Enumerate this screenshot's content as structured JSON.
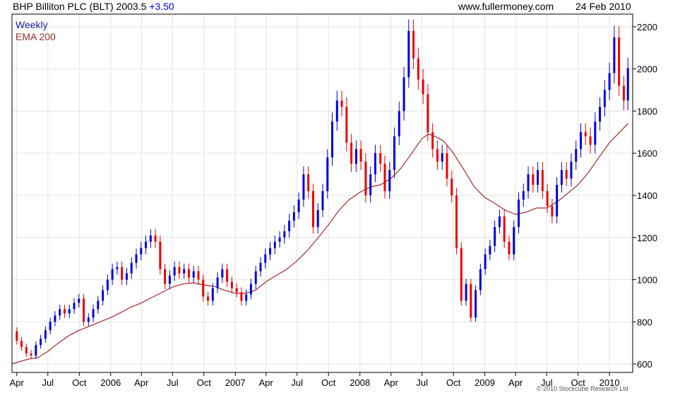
{
  "header": {
    "title": "BHP Billiton PLC (BLT) 2003.5",
    "change": "+3.50",
    "site": "www.fullermoney.com",
    "date": "24 Feb 2010"
  },
  "legend": {
    "weekly": "Weekly",
    "ema": "EMA 200"
  },
  "copyright": "© 2010 Stockcube Research Ltd",
  "colors": {
    "up": "#0000dd",
    "down": "#ee0000",
    "ema": "#a52a2a",
    "grid": "#e3e3e3",
    "frame": "#000000"
  },
  "chart_data": {
    "type": "line",
    "title": "BHP Billiton PLC (BLT)",
    "xlabel": "",
    "ylabel": "",
    "ylim": [
      560,
      2260
    ],
    "y_ticks": [
      600,
      800,
      1000,
      1200,
      1400,
      1600,
      1800,
      2000,
      2200
    ],
    "x_tick_labels": [
      "Apr",
      "Jul",
      "Oct",
      "2006",
      "Apr",
      "Jul",
      "Oct",
      "2007",
      "Apr",
      "Jul",
      "Oct",
      "2008",
      "Apr",
      "Jul",
      "Oct",
      "2009",
      "Apr",
      "Jul",
      "Oct",
      "2010"
    ],
    "x_range": [
      "2005-03-18",
      "2010-02-24"
    ],
    "grid": true,
    "series": [
      {
        "name": "Weekly",
        "style": "bars",
        "points": [
          [
            "2005-03-18",
            755
          ],
          [
            "2005-04-01",
            710
          ],
          [
            "2005-04-15",
            680
          ],
          [
            "2005-04-29",
            650
          ],
          [
            "2005-05-13",
            640
          ],
          [
            "2005-05-27",
            690
          ],
          [
            "2005-06-10",
            720
          ],
          [
            "2005-06-24",
            760
          ],
          [
            "2005-07-08",
            800
          ],
          [
            "2005-07-22",
            830
          ],
          [
            "2005-08-05",
            860
          ],
          [
            "2005-08-19",
            840
          ],
          [
            "2005-09-02",
            860
          ],
          [
            "2005-09-16",
            890
          ],
          [
            "2005-09-30",
            910
          ],
          [
            "2005-10-14",
            800
          ],
          [
            "2005-10-28",
            820
          ],
          [
            "2005-11-11",
            860
          ],
          [
            "2005-11-25",
            900
          ],
          [
            "2005-12-09",
            950
          ],
          [
            "2005-12-23",
            1000
          ],
          [
            "2006-01-06",
            1050
          ],
          [
            "2006-01-20",
            1060
          ],
          [
            "2006-02-03",
            1000
          ],
          [
            "2006-02-17",
            1030
          ],
          [
            "2006-03-03",
            1080
          ],
          [
            "2006-03-17",
            1120
          ],
          [
            "2006-03-31",
            1150
          ],
          [
            "2006-04-14",
            1180
          ],
          [
            "2006-04-28",
            1210
          ],
          [
            "2006-05-12",
            1180
          ],
          [
            "2006-05-26",
            1050
          ],
          [
            "2006-06-09",
            980
          ],
          [
            "2006-06-23",
            1020
          ],
          [
            "2006-07-07",
            1060
          ],
          [
            "2006-07-21",
            1030
          ],
          [
            "2006-08-04",
            1050
          ],
          [
            "2006-08-18",
            1010
          ],
          [
            "2006-09-01",
            1040
          ],
          [
            "2006-09-15",
            1000
          ],
          [
            "2006-09-29",
            920
          ],
          [
            "2006-10-13",
            900
          ],
          [
            "2006-10-27",
            960
          ],
          [
            "2006-11-10",
            1010
          ],
          [
            "2006-11-24",
            1050
          ],
          [
            "2006-12-08",
            990
          ],
          [
            "2006-12-22",
            960
          ],
          [
            "2007-01-05",
            940
          ],
          [
            "2007-01-19",
            900
          ],
          [
            "2007-02-02",
            930
          ],
          [
            "2007-02-16",
            980
          ],
          [
            "2007-03-02",
            1040
          ],
          [
            "2007-03-16",
            1080
          ],
          [
            "2007-03-30",
            1120
          ],
          [
            "2007-04-13",
            1150
          ],
          [
            "2007-04-27",
            1180
          ],
          [
            "2007-05-11",
            1200
          ],
          [
            "2007-05-25",
            1230
          ],
          [
            "2007-06-08",
            1280
          ],
          [
            "2007-06-22",
            1320
          ],
          [
            "2007-07-06",
            1380
          ],
          [
            "2007-07-20",
            1500
          ],
          [
            "2007-08-03",
            1420
          ],
          [
            "2007-08-17",
            1250
          ],
          [
            "2007-08-31",
            1330
          ],
          [
            "2007-09-14",
            1420
          ],
          [
            "2007-09-28",
            1580
          ],
          [
            "2007-10-12",
            1750
          ],
          [
            "2007-10-26",
            1850
          ],
          [
            "2007-11-09",
            1820
          ],
          [
            "2007-11-23",
            1650
          ],
          [
            "2007-12-07",
            1550
          ],
          [
            "2007-12-21",
            1620
          ],
          [
            "2008-01-04",
            1560
          ],
          [
            "2008-01-18",
            1400
          ],
          [
            "2008-02-01",
            1500
          ],
          [
            "2008-02-15",
            1600
          ],
          [
            "2008-03-01",
            1550
          ],
          [
            "2008-03-14",
            1420
          ],
          [
            "2008-03-28",
            1520
          ],
          [
            "2008-04-11",
            1680
          ],
          [
            "2008-04-25",
            1800
          ],
          [
            "2008-05-09",
            1960
          ],
          [
            "2008-05-23",
            2180
          ],
          [
            "2008-06-06",
            2050
          ],
          [
            "2008-06-20",
            1950
          ],
          [
            "2008-07-04",
            1880
          ],
          [
            "2008-07-18",
            1700
          ],
          [
            "2008-08-01",
            1620
          ],
          [
            "2008-08-15",
            1560
          ],
          [
            "2008-08-29",
            1600
          ],
          [
            "2008-09-12",
            1480
          ],
          [
            "2008-09-26",
            1400
          ],
          [
            "2008-10-10",
            1150
          ],
          [
            "2008-10-24",
            900
          ],
          [
            "2008-11-07",
            980
          ],
          [
            "2008-11-21",
            820
          ],
          [
            "2008-12-05",
            950
          ],
          [
            "2008-12-19",
            1050
          ],
          [
            "2009-01-02",
            1120
          ],
          [
            "2009-01-16",
            1160
          ],
          [
            "2009-01-30",
            1250
          ],
          [
            "2009-02-13",
            1300
          ],
          [
            "2009-02-27",
            1180
          ],
          [
            "2009-03-13",
            1120
          ],
          [
            "2009-03-27",
            1250
          ],
          [
            "2009-04-10",
            1380
          ],
          [
            "2009-04-24",
            1420
          ],
          [
            "2009-05-08",
            1500
          ],
          [
            "2009-05-22",
            1450
          ],
          [
            "2009-06-05",
            1520
          ],
          [
            "2009-06-19",
            1420
          ],
          [
            "2009-07-03",
            1350
          ],
          [
            "2009-07-17",
            1300
          ],
          [
            "2009-07-31",
            1450
          ],
          [
            "2009-08-14",
            1520
          ],
          [
            "2009-08-28",
            1480
          ],
          [
            "2009-09-11",
            1560
          ],
          [
            "2009-09-25",
            1620
          ],
          [
            "2009-10-09",
            1700
          ],
          [
            "2009-10-23",
            1680
          ],
          [
            "2009-11-06",
            1640
          ],
          [
            "2009-11-20",
            1750
          ],
          [
            "2009-12-04",
            1820
          ],
          [
            "2009-12-18",
            1900
          ],
          [
            "2010-01-01",
            1980
          ],
          [
            "2010-01-15",
            2150
          ],
          [
            "2010-01-29",
            1920
          ],
          [
            "2010-02-12",
            1850
          ],
          [
            "2010-02-24",
            2003.5
          ]
        ]
      },
      {
        "name": "EMA 200",
        "style": "line",
        "points": [
          [
            "2005-03-18",
            600
          ],
          [
            "2005-05-01",
            622
          ],
          [
            "2005-06-01",
            630
          ],
          [
            "2005-07-01",
            660
          ],
          [
            "2005-08-01",
            700
          ],
          [
            "2005-09-01",
            735
          ],
          [
            "2005-10-01",
            760
          ],
          [
            "2005-11-01",
            780
          ],
          [
            "2005-12-01",
            800
          ],
          [
            "2006-01-01",
            820
          ],
          [
            "2006-02-01",
            845
          ],
          [
            "2006-03-01",
            870
          ],
          [
            "2006-04-01",
            890
          ],
          [
            "2006-05-01",
            915
          ],
          [
            "2006-06-01",
            940
          ],
          [
            "2006-07-01",
            965
          ],
          [
            "2006-08-01",
            980
          ],
          [
            "2006-09-01",
            985
          ],
          [
            "2006-10-01",
            975
          ],
          [
            "2006-11-01",
            968
          ],
          [
            "2006-12-01",
            950
          ],
          [
            "2007-01-01",
            935
          ],
          [
            "2007-02-01",
            935
          ],
          [
            "2007-03-01",
            950
          ],
          [
            "2007-04-01",
            990
          ],
          [
            "2007-05-01",
            1020
          ],
          [
            "2007-06-01",
            1050
          ],
          [
            "2007-07-01",
            1090
          ],
          [
            "2007-08-01",
            1140
          ],
          [
            "2007-09-01",
            1200
          ],
          [
            "2007-10-01",
            1260
          ],
          [
            "2007-11-01",
            1330
          ],
          [
            "2007-12-01",
            1380
          ],
          [
            "2008-01-01",
            1415
          ],
          [
            "2008-02-01",
            1440
          ],
          [
            "2008-03-01",
            1450
          ],
          [
            "2008-04-01",
            1480
          ],
          [
            "2008-05-01",
            1530
          ],
          [
            "2008-06-01",
            1600
          ],
          [
            "2008-07-01",
            1670
          ],
          [
            "2008-07-20",
            1690
          ],
          [
            "2008-08-01",
            1685
          ],
          [
            "2008-09-01",
            1660
          ],
          [
            "2008-10-01",
            1600
          ],
          [
            "2008-11-01",
            1520
          ],
          [
            "2008-12-01",
            1440
          ],
          [
            "2009-01-01",
            1390
          ],
          [
            "2009-02-01",
            1360
          ],
          [
            "2009-03-01",
            1330
          ],
          [
            "2009-04-01",
            1310
          ],
          [
            "2009-05-01",
            1320
          ],
          [
            "2009-06-01",
            1340
          ],
          [
            "2009-07-01",
            1340
          ],
          [
            "2009-08-01",
            1370
          ],
          [
            "2009-09-01",
            1410
          ],
          [
            "2009-10-01",
            1450
          ],
          [
            "2009-11-01",
            1510
          ],
          [
            "2009-12-01",
            1580
          ],
          [
            "2010-01-01",
            1650
          ],
          [
            "2010-02-24",
            1740
          ]
        ]
      }
    ]
  }
}
